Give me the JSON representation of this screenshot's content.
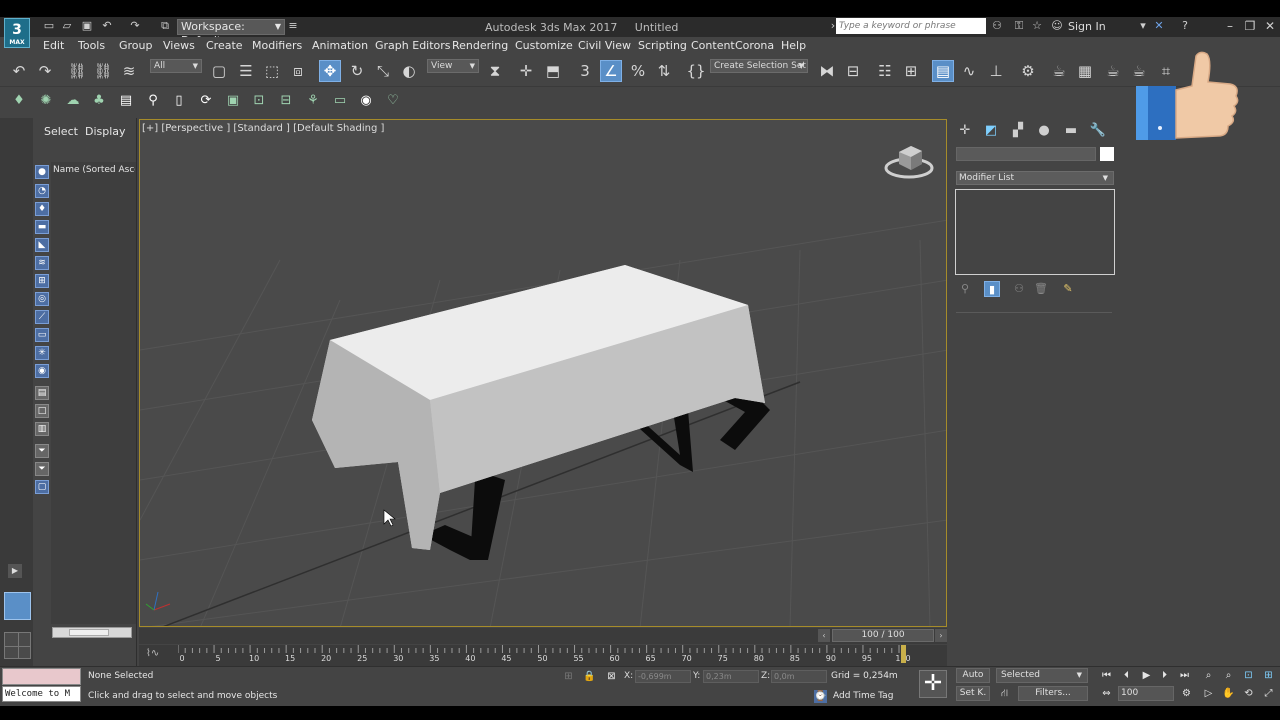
{
  "app": {
    "logo_text": "3",
    "logo_sub": "MAX",
    "title": "Autodesk 3ds Max 2017     Untitled",
    "workspace": "Workspace: Default",
    "search_placeholder": "Type a keyword or phrase",
    "sign_in": "Sign In"
  },
  "menu": [
    "Edit",
    "Tools",
    "Group",
    "Views",
    "Create",
    "Modifiers",
    "Animation",
    "Graph Editors",
    "Rendering",
    "Customize",
    "Civil View",
    "Scripting",
    "Content",
    "Corona",
    "Help"
  ],
  "toolbar": {
    "filter_value": "All",
    "ref_coord_value": "View",
    "selection_set_value": "Create Selection Set"
  },
  "scene_explorer": {
    "tab_select": "Select",
    "tab_display": "Display",
    "column_header": "Name (Sorted Ascending)"
  },
  "viewport": {
    "label": "[+] [Perspective ] [Standard ] [Default Shading ]"
  },
  "command_panel": {
    "modifier_list": "Modifier List",
    "swatch_color": "#ffffff"
  },
  "timeline": {
    "frame_display": "100 / 100",
    "ticks": [
      "0",
      "5",
      "10",
      "15",
      "20",
      "25",
      "30",
      "35",
      "40",
      "45",
      "50",
      "55",
      "60",
      "65",
      "70",
      "75",
      "80",
      "85",
      "90",
      "95",
      "100"
    ]
  },
  "status": {
    "selection": "None Selected",
    "prompt": "Click and drag to select and move objects",
    "maxscript_listener": "Welcome to M",
    "x_label": "X:",
    "x_value": "-0,699m",
    "y_label": "Y:",
    "y_value": "0,23m",
    "z_label": "Z:",
    "z_value": "0,0m",
    "grid": "Grid = 0,254m",
    "add_time_tag": "Add Time Tag",
    "auto_key": "Auto",
    "set_key": "Set K.",
    "key_filter_value": "Selected",
    "filters": "Filters...",
    "frame_value": "100"
  },
  "colors": {
    "accent_active": "#5a8fc7",
    "viewport_border": "#a68c2a"
  }
}
